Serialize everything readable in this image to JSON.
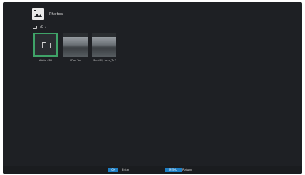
{
  "header": {
    "icon": "photos-icon",
    "title": "Photos"
  },
  "path": {
    "icon": "drive-icon",
    "text": "/C :"
  },
  "items": [
    {
      "type": "folder",
      "icon": "folder-icon",
      "caption": "Adata - 3D"
    },
    {
      "type": "photo",
      "caption": "I Plan You"
    },
    {
      "type": "photo",
      "caption": "Send My Love_To T"
    }
  ],
  "footer": {
    "ok_key": "OK",
    "ok_label": "Enter",
    "menu_key": "MENU",
    "menu_label": "Return"
  },
  "colors": {
    "background": "#1e2024",
    "selection": "#3fa368",
    "key_accent": "#1f7fc4"
  }
}
